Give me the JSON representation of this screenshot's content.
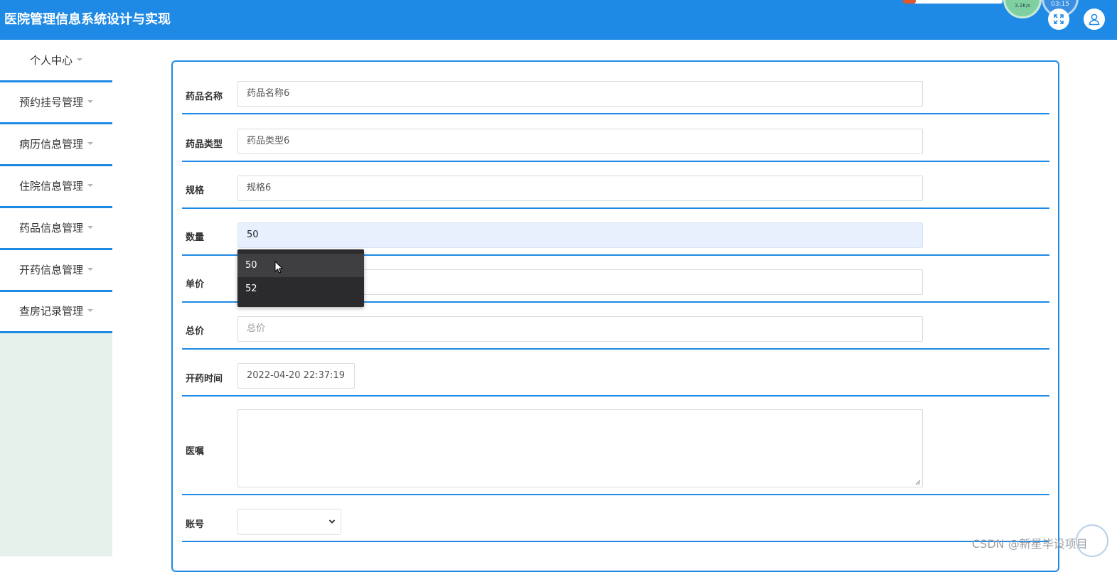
{
  "header": {
    "title": "医院管理信息系统设计与实现",
    "widget_speed": "3.2K/s",
    "widget_time": "03:15"
  },
  "sidebar": {
    "items": [
      {
        "label": "个人中心"
      },
      {
        "label": "预约挂号管理"
      },
      {
        "label": "病历信息管理"
      },
      {
        "label": "住院信息管理"
      },
      {
        "label": "药品信息管理"
      },
      {
        "label": "开药信息管理"
      },
      {
        "label": "查房记录管理"
      }
    ]
  },
  "form": {
    "drug_name": {
      "label": "药品名称",
      "value": "药品名称6"
    },
    "drug_type": {
      "label": "药品类型",
      "value": "药品类型6"
    },
    "spec": {
      "label": "规格",
      "value": "规格6"
    },
    "quantity": {
      "label": "数量",
      "value": "50"
    },
    "unit_price": {
      "label": "单价",
      "value": ""
    },
    "total_price": {
      "label": "总价",
      "placeholder": "总价"
    },
    "prescribe_time": {
      "label": "开药时间",
      "value": "2022-04-20 22:37:19"
    },
    "advice": {
      "label": "医嘱",
      "value": ""
    },
    "account": {
      "label": "账号",
      "value": ""
    }
  },
  "autocomplete": {
    "options": [
      "50",
      "52"
    ]
  },
  "watermark": "CSDN @新星毕设项目",
  "colors": {
    "primary": "#1f8ae6",
    "sidebar_bg": "#e7f1ec"
  }
}
